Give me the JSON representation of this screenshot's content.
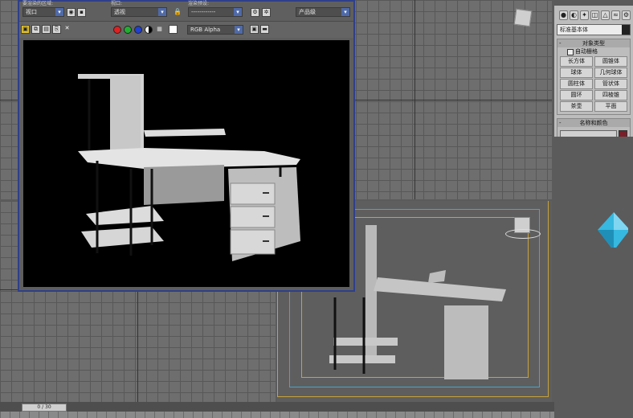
{
  "render_window": {
    "toolbar1": {
      "area_label": "要渲染的区域:",
      "area_value": "视口",
      "viewport_label": "视口:",
      "viewport_value": "透视",
      "preset_label": "渲染预设:",
      "preset_value": "------------",
      "product_value": "产品级"
    },
    "toolbar2": {
      "channel_value": "RGB Alpha"
    }
  },
  "command_panel": {
    "category_value": "标准基本体",
    "object_type": {
      "header": "对象类型",
      "autogrid": "自动栅格",
      "buttons": [
        "长方体",
        "圆锥体",
        "球体",
        "几何球体",
        "圆柱体",
        "管状体",
        "圆环",
        "四棱锥",
        "茶壶",
        "平面"
      ]
    },
    "name_color": {
      "header": "名称和颜色"
    }
  },
  "timeline": {
    "frame_value": "0 / 30"
  },
  "colors": {
    "name_swatch": "#7a1f2a",
    "window_border": "#2e3f8a",
    "safe_frame_outer": "#c8a23a",
    "safe_frame_inner": "#4aa3c8",
    "gem": "#36b8e0"
  },
  "icons": [
    "lock-icon",
    "save-icon",
    "clone-icon",
    "clear-icon",
    "red-channel-icon",
    "green-channel-icon",
    "blue-channel-icon",
    "mono-icon",
    "alpha-icon",
    "settings-icon",
    "close-icon",
    "view-cube-icon",
    "logo-gem-icon"
  ]
}
